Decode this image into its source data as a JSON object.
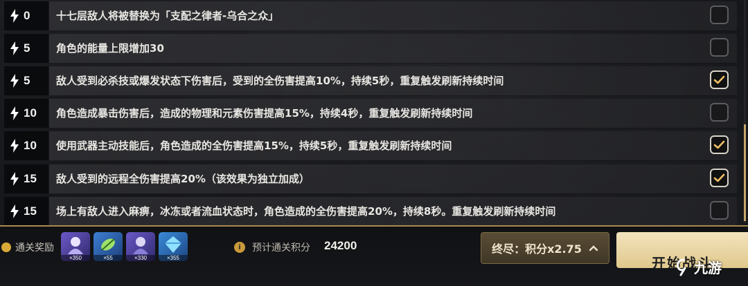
{
  "rows": [
    {
      "cost": "0",
      "text": "十七层敌人将被替换为「支配之律者-乌合之众」",
      "checked": false
    },
    {
      "cost": "5",
      "text": "角色的能量上限增加30",
      "checked": false
    },
    {
      "cost": "5",
      "text": "敌人受到必杀技或爆发状态下伤害后，受到的全伤害提高10%，持续5秒，重复触发刷新持续时间",
      "checked": true
    },
    {
      "cost": "10",
      "text": "角色造成暴击伤害后，造成的物理和元素伤害提高15%，持续4秒，重复触发刷新持续时间",
      "checked": false
    },
    {
      "cost": "10",
      "text": "使用武器主动技能后，角色造成的全伤害提高15%，持续5秒，重复触发刷新持续时间",
      "checked": true
    },
    {
      "cost": "15",
      "text": "敌人受到的远程全伤害提高20%（该效果为独立加成）",
      "checked": true
    },
    {
      "cost": "15",
      "text": "场上有敌人进入麻痹，冰冻或者流血状态时，角色造成的全伤害提高20%，持续8秒。重复触发刷新持续时间",
      "checked": false
    }
  ],
  "rewards": {
    "label": "通关奖励",
    "items": [
      {
        "icon": "character-icon",
        "qty": "×350"
      },
      {
        "icon": "leaf-crystal-icon",
        "qty": "×55"
      },
      {
        "icon": "character-icon",
        "qty": "×330"
      },
      {
        "icon": "crystal-icon",
        "qty": "×355"
      }
    ]
  },
  "score": {
    "label": "预计通关积分",
    "value": "24200"
  },
  "mode_button": {
    "label": "终尽：积分x2.75"
  },
  "start_button": {
    "label": "开始战斗"
  },
  "watermark": {
    "text": "九游"
  },
  "colors": {
    "accent": "#c9a86a",
    "button_gold": "#e0c88c"
  }
}
